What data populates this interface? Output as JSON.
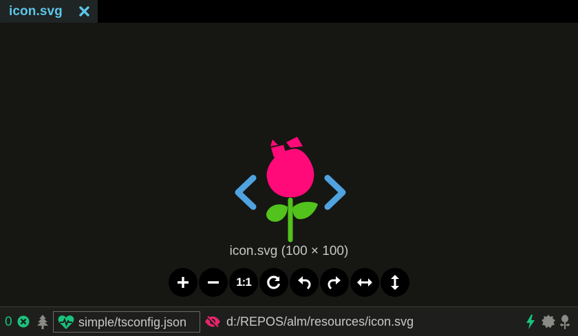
{
  "colors": {
    "tab_text": "#5cc6e8",
    "background": "#161613",
    "status_green": "#19c37d",
    "status_pink": "#e8246c",
    "rose_pink": "#ff0a78",
    "leaf_green": "#52c21c",
    "bracket_blue": "#4fa3e0"
  },
  "tab": {
    "title": "icon.svg",
    "close_icon": "close-icon"
  },
  "viewer": {
    "image_icon": "rose-code-icon",
    "caption": "icon.svg (100 × 100)",
    "tools": [
      {
        "name": "zoom-in",
        "icon": "plus-icon"
      },
      {
        "name": "zoom-out",
        "icon": "minus-icon"
      },
      {
        "name": "actual-size",
        "label": "1:1"
      },
      {
        "name": "reset",
        "icon": "refresh-icon"
      },
      {
        "name": "rotate-left",
        "icon": "undo-icon"
      },
      {
        "name": "rotate-right",
        "icon": "redo-icon"
      },
      {
        "name": "flip-horizontal",
        "icon": "arrows-h-icon"
      },
      {
        "name": "flip-vertical",
        "icon": "arrows-v-icon"
      }
    ]
  },
  "statusbar": {
    "error_count": "0",
    "project": "simple/tsconfig.json",
    "file_path": "d:/REPOS/alm/resources/icon.svg"
  }
}
